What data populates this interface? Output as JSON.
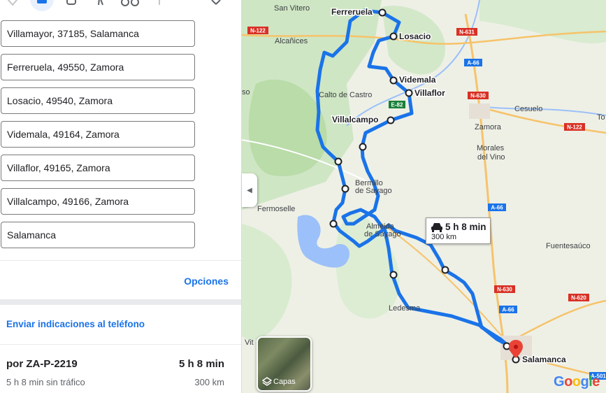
{
  "destinations": [
    "Villamayor, 37185, Salamanca",
    "Ferreruela, 49550, Zamora",
    "Losacio, 49540, Zamora",
    "Videmala, 49164, Zamora",
    "Villaflor, 49165, Zamora",
    "Villalcampo, 49166, Zamora",
    "Salamanca"
  ],
  "options_label": "Opciones",
  "send_label": "Enviar indicaciones al teléfono",
  "route": {
    "name": "por ZA-P-2219",
    "time": "5 h 8 min",
    "sub": "5 h 8 min sin tráfico",
    "distance": "300 km"
  },
  "map": {
    "tooltip_time": "5 h 8 min",
    "tooltip_distance": "300 km",
    "layers_label": "Capas",
    "route_color": "#1a73e8",
    "places": {
      "san_vitero": "San Vitero",
      "ferreruela": "Ferreruela",
      "losacio": "Losacio",
      "alcanices": "Alcañices",
      "videmala": "Videmala",
      "villaflor": "Villaflor",
      "calto": "Calto de Castro",
      "villalcampo": "Villalcampo",
      "cesuelo": "Cesuelo",
      "zamora": "Zamora",
      "morales": "Morales",
      "del_vino": "del Vino",
      "bermillo": "Bermillo",
      "de_sayago": "de Sayago",
      "fermoselle": "Fermoselle",
      "almeida": "Almeida",
      "de_sayago2": "de Sayago",
      "fuentesauco": "Fuentesaúco",
      "ledesma": "Ledesma",
      "salamanca": "Salamanca",
      "so": "so",
      "to": "To",
      "vit": "Vit"
    },
    "roads": {
      "n122a": "N-122",
      "n631": "N-631",
      "a66a": "A-66",
      "n630a": "N-630",
      "e82": "E-82",
      "n122b": "N-122",
      "a66b": "A-66",
      "n630b": "N-630",
      "a66c": "A-66",
      "n620": "N-620",
      "a501": "A-501"
    },
    "google_letters": [
      "G",
      "o",
      "o",
      "g",
      "l",
      "e"
    ]
  }
}
